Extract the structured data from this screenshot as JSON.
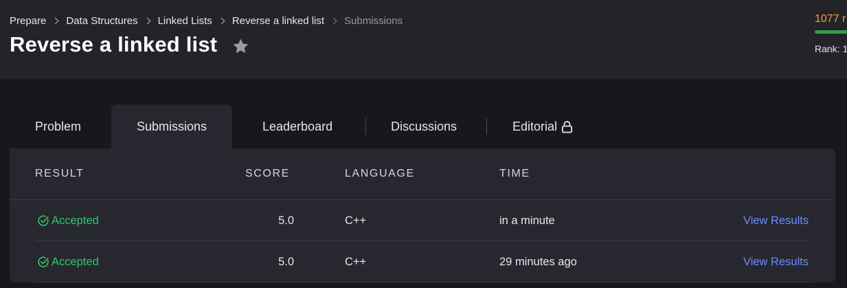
{
  "breadcrumb": {
    "items": [
      "Prepare",
      "Data Structures",
      "Linked Lists",
      "Reverse a linked list"
    ],
    "current": "Submissions"
  },
  "page": {
    "title": "Reverse a linked list",
    "star_icon": "star-icon"
  },
  "profile": {
    "score_text": "1077 r",
    "score_progress": 1.0,
    "rank_label": "Rank: 1"
  },
  "tabs": {
    "problem": "Problem",
    "submissions": "Submissions",
    "leaderboard": "Leaderboard",
    "discussions": "Discussions",
    "editorial": "Editorial",
    "editorial_icon": "lock-icon",
    "active": "Submissions"
  },
  "table": {
    "columns": [
      "RESULT",
      "SCORE",
      "LANGUAGE",
      "TIME"
    ],
    "rows": [
      {
        "result": "Accepted",
        "score": "5.0",
        "language": "C++",
        "time": "in a minute",
        "action": "View Results"
      },
      {
        "result": "Accepted",
        "score": "5.0",
        "language": "C++",
        "time": "29 minutes ago",
        "action": "View Results"
      }
    ]
  },
  "colors": {
    "accepted": "#2ec866",
    "link": "#6a8cff",
    "score": "#f0a14a",
    "progress": "#2ea043"
  }
}
